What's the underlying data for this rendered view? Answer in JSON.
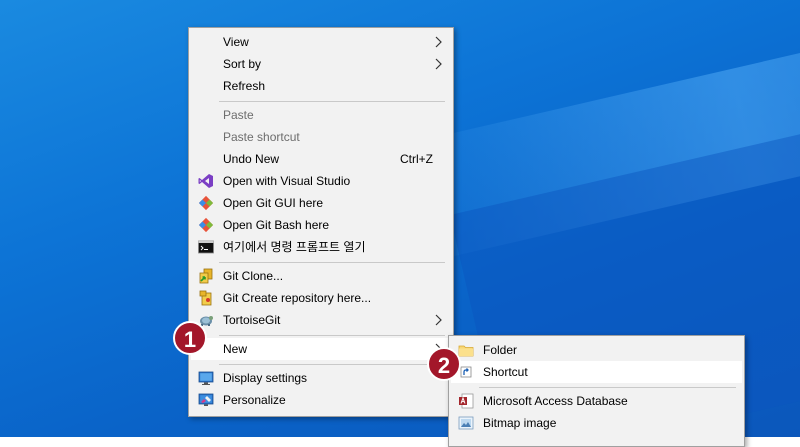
{
  "context_menu": {
    "items": [
      {
        "label": "View"
      },
      {
        "label": "Sort by"
      },
      {
        "label": "Refresh"
      },
      {
        "label": "Paste"
      },
      {
        "label": "Paste shortcut"
      },
      {
        "label": "Undo New",
        "shortcut": "Ctrl+Z"
      },
      {
        "label": "Open with Visual Studio"
      },
      {
        "label": "Open Git GUI here"
      },
      {
        "label": "Open Git Bash here"
      },
      {
        "label": "여기에서 명령 프롬프트 열기"
      },
      {
        "label": "Git Clone..."
      },
      {
        "label": "Git Create repository here..."
      },
      {
        "label": "TortoiseGit"
      },
      {
        "label": "New"
      },
      {
        "label": "Display settings"
      },
      {
        "label": "Personalize"
      }
    ]
  },
  "new_submenu": {
    "items": [
      {
        "label": "Folder"
      },
      {
        "label": "Shortcut"
      },
      {
        "label": "Microsoft Access Database"
      },
      {
        "label": "Bitmap image"
      }
    ]
  },
  "badges": {
    "step1": "1",
    "step2": "2",
    "color": "#a3172a"
  },
  "icons": {
    "visual_studio": "visual-studio-icon",
    "git_gui": "git-icon",
    "git_bash": "git-icon",
    "cmd": "command-prompt-icon",
    "git_clone": "git-clone-icon",
    "git_create": "git-create-repo-icon",
    "tortoise": "tortoisegit-icon",
    "display": "display-settings-icon",
    "personalize": "personalize-icon",
    "folder": "folder-icon",
    "shortcut": "shortcut-icon",
    "access": "access-icon",
    "bitmap": "bitmap-icon"
  }
}
